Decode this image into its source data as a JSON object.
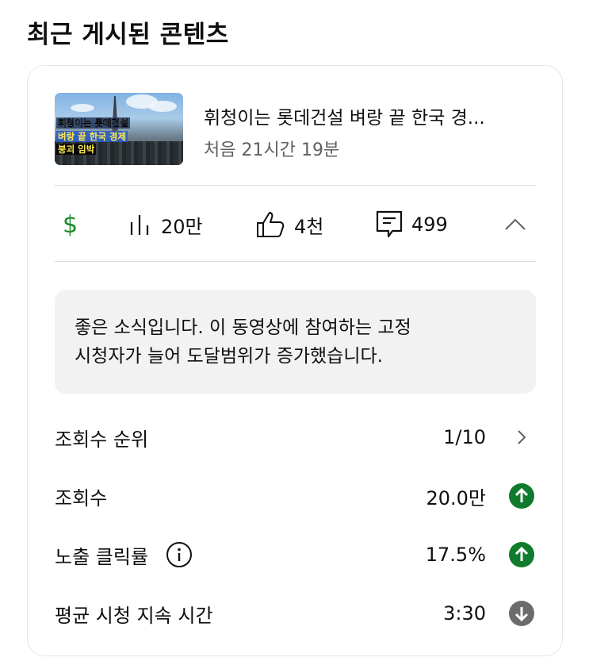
{
  "section": {
    "title": "최근 게시된 콘텐츠"
  },
  "video": {
    "thumbnail_captions": [
      "휘청이는 롯데건설",
      "벼랑 끝 한국 경제",
      "붕괴 임박"
    ],
    "title": "휘청이는 롯데건설 벼랑 끝 한국 경...",
    "meta": "처음 21시간 19분"
  },
  "stats": {
    "revenue_icon": "$",
    "views": "20만",
    "likes": "4천",
    "comments": "499"
  },
  "message": {
    "line1": "좋은 소식입니다. 이 동영상에 참여하는 고정",
    "line2": "시청자가 늘어 도달범위가 증가했습니다."
  },
  "metrics": [
    {
      "label": "조회수 순위",
      "value": "1/10",
      "icon": "chevron-right-icon"
    },
    {
      "label": "조회수",
      "value": "20.0만",
      "icon": "arrow-up-icon",
      "color": "#0f7b2c"
    },
    {
      "label": "노출 클릭률",
      "value": "17.5%",
      "icon": "arrow-up-icon",
      "color": "#0f7b2c"
    },
    {
      "label": "평균 시청 지속 시간",
      "value": "3:30",
      "icon": "arrow-down-icon",
      "color": "#6b6b6b"
    }
  ],
  "colors": {
    "positive": "#0f7b2c",
    "neutral": "#6b6b6b",
    "revenue": "#1a8a2a"
  }
}
